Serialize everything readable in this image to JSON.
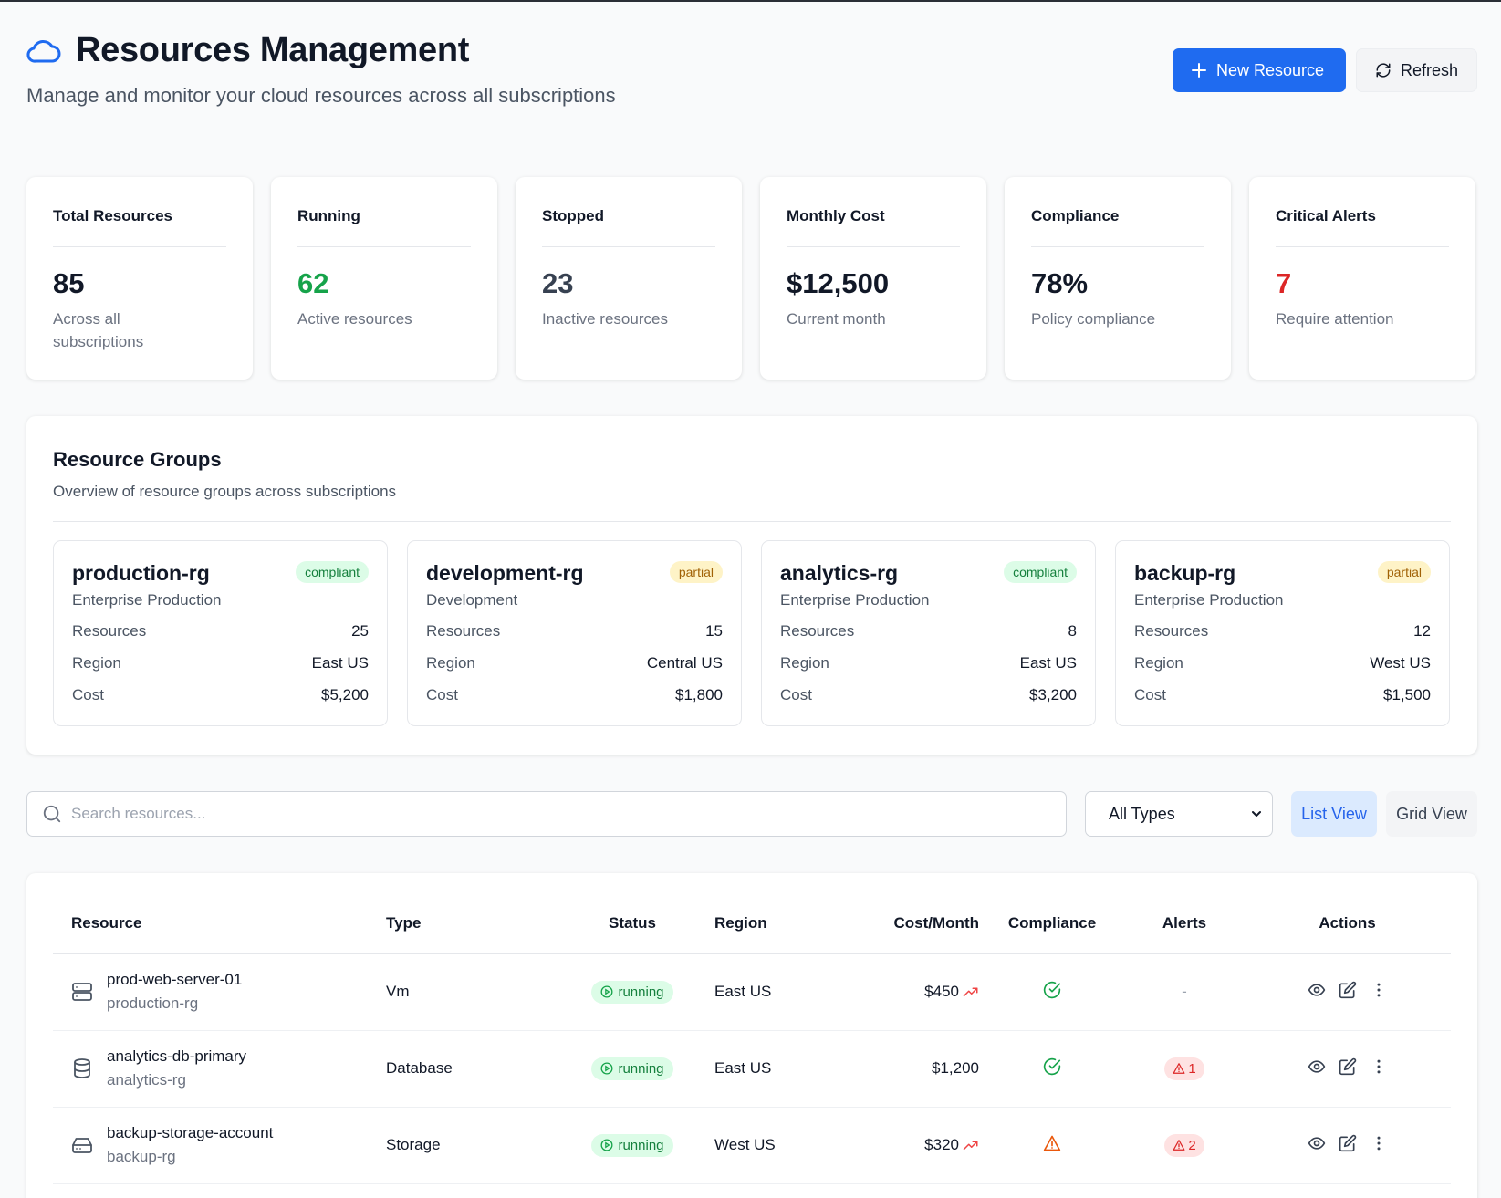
{
  "header": {
    "title": "Resources Management",
    "subtitle": "Manage and monitor your cloud resources across all subscriptions",
    "new_resource_label": "New Resource",
    "refresh_label": "Refresh"
  },
  "stats": [
    {
      "label": "Total Resources",
      "value": "85",
      "sub": "Across all subscriptions"
    },
    {
      "label": "Running",
      "value": "62",
      "sub": "Active resources"
    },
    {
      "label": "Stopped",
      "value": "23",
      "sub": "Inactive resources"
    },
    {
      "label": "Monthly Cost",
      "value": "$12,500",
      "sub": "Current month"
    },
    {
      "label": "Compliance",
      "value": "78%",
      "sub": "Policy compliance"
    },
    {
      "label": "Critical Alerts",
      "value": "7",
      "sub": "Require attention"
    }
  ],
  "groups": {
    "title": "Resource Groups",
    "subtitle": "Overview of resource groups across subscriptions",
    "row_labels": {
      "resources": "Resources",
      "region": "Region",
      "cost": "Cost"
    },
    "items": [
      {
        "name": "production-rg",
        "subscription": "Enterprise Production",
        "badge": "compliant",
        "resources": "25",
        "region": "East US",
        "cost": "$5,200"
      },
      {
        "name": "development-rg",
        "subscription": "Development",
        "badge": "partial",
        "resources": "15",
        "region": "Central US",
        "cost": "$1,800"
      },
      {
        "name": "analytics-rg",
        "subscription": "Enterprise Production",
        "badge": "compliant",
        "resources": "8",
        "region": "East US",
        "cost": "$3,200"
      },
      {
        "name": "backup-rg",
        "subscription": "Enterprise Production",
        "badge": "partial",
        "resources": "12",
        "region": "West US",
        "cost": "$1,500"
      }
    ]
  },
  "toolbar": {
    "search_placeholder": "Search resources...",
    "type_filter_selected": "All Types",
    "list_view_label": "List View",
    "grid_view_label": "Grid View"
  },
  "table": {
    "headers": {
      "resource": "Resource",
      "type": "Type",
      "status": "Status",
      "region": "Region",
      "cost": "Cost/Month",
      "compliance": "Compliance",
      "alerts": "Alerts",
      "actions": "Actions"
    },
    "rows": [
      {
        "name": "prod-web-server-01",
        "group": "production-rg",
        "type": "Vm",
        "icon": "server-icon",
        "status": "running",
        "region": "East US",
        "cost": "$450",
        "trend": "up",
        "compliance": "check",
        "alerts": "-"
      },
      {
        "name": "analytics-db-primary",
        "group": "analytics-rg",
        "type": "Database",
        "icon": "database-icon",
        "status": "running",
        "region": "East US",
        "cost": "$1,200",
        "trend": "none",
        "compliance": "check",
        "alerts": "1"
      },
      {
        "name": "backup-storage-account",
        "group": "backup-rg",
        "type": "Storage",
        "icon": "hard-drive-icon",
        "status": "running",
        "region": "West US",
        "cost": "$320",
        "trend": "up",
        "compliance": "warning",
        "alerts": "2"
      }
    ]
  },
  "colors": {
    "accent": "#1f6bf0",
    "running": "#16a34a",
    "stopped": "#374151",
    "critical": "#dc2626"
  }
}
